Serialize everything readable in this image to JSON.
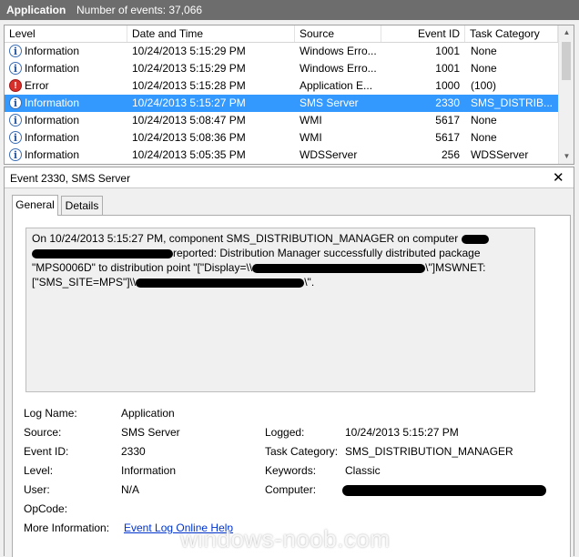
{
  "header": {
    "title": "Application",
    "count_text": "Number of events: 37,066"
  },
  "columns": [
    "Level",
    "Date and Time",
    "Source",
    "Event ID",
    "Task Category"
  ],
  "rows": [
    {
      "level": "Information",
      "icon": "info-icon",
      "date": "10/24/2013 5:15:29 PM",
      "source": "Windows Erro...",
      "id": "1001",
      "task": "None"
    },
    {
      "level": "Information",
      "icon": "info-icon",
      "date": "10/24/2013 5:15:29 PM",
      "source": "Windows Erro...",
      "id": "1001",
      "task": "None"
    },
    {
      "level": "Error",
      "icon": "error-icon",
      "date": "10/24/2013 5:15:28 PM",
      "source": "Application E...",
      "id": "1000",
      "task": "(100)"
    },
    {
      "level": "Information",
      "icon": "info-icon",
      "date": "10/24/2013 5:15:27 PM",
      "source": "SMS Server",
      "id": "2330",
      "task": "SMS_DISTRIB..."
    },
    {
      "level": "Information",
      "icon": "info-icon",
      "date": "10/24/2013 5:08:47 PM",
      "source": "WMI",
      "id": "5617",
      "task": "None"
    },
    {
      "level": "Information",
      "icon": "info-icon",
      "date": "10/24/2013 5:08:36 PM",
      "source": "WMI",
      "id": "5617",
      "task": "None"
    },
    {
      "level": "Information",
      "icon": "info-icon",
      "date": "10/24/2013 5:05:35 PM",
      "source": "WDSServer",
      "id": "256",
      "task": "WDSServer"
    }
  ],
  "selected_row": 3,
  "detail": {
    "title": "Event 2330, SMS Server",
    "close_glyph": "✕",
    "tabs": [
      "General",
      "Details"
    ],
    "desc_lines": [
      "On 10/24/2013 5:15:27 PM, component SMS_DISTRIBUTION_MANAGER on computer",
      "reported:  Distribution Manager successfully distributed package",
      "\"MPS0006D\" to distribution point \"[\"Display=\\\\",
      "\\\"]MSWNET:",
      "[\"SMS_SITE=MPS\"]\\\\",
      "\\\"."
    ],
    "labels": {
      "log_name": "Log Name:",
      "source": "Source:",
      "event_id": "Event ID:",
      "level": "Level:",
      "user": "User:",
      "opcode": "OpCode:",
      "more_info": "More Information:",
      "logged": "Logged:",
      "task_category": "Task Category:",
      "keywords": "Keywords:",
      "computer": "Computer:"
    },
    "values": {
      "log_name": "Application",
      "source": "SMS Server",
      "event_id": "2330",
      "level": "Information",
      "user": "N/A",
      "more_info_link": "Event Log Online Help",
      "logged": "10/24/2013 5:15:27 PM",
      "task_category": "SMS_DISTRIBUTION_MANAGER",
      "keywords": "Classic"
    }
  },
  "watermark": "windows-noob.com"
}
